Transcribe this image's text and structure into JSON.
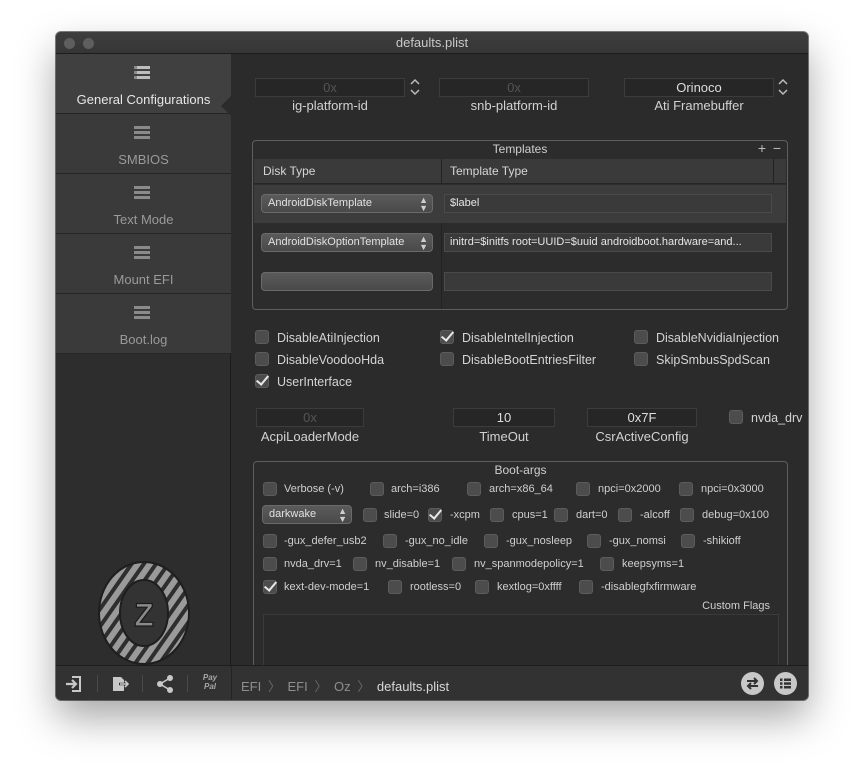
{
  "window": {
    "title": "defaults.plist"
  },
  "sidebar": {
    "items": [
      {
        "label": "General Configurations",
        "active": true
      },
      {
        "label": "SMBIOS",
        "active": false
      },
      {
        "label": "Text Mode",
        "active": false
      },
      {
        "label": "Mount EFI",
        "active": false
      },
      {
        "label": "Boot.log",
        "active": false
      }
    ],
    "logo_letter": "Z"
  },
  "platform": {
    "ig_platform_id": {
      "value": "0x",
      "label": "ig-platform-id"
    },
    "snb_platform_id": {
      "value": "0x",
      "label": "snb-platform-id"
    },
    "ati_framebuffer": {
      "value": "Orinoco",
      "label": "Ati Framebuffer"
    }
  },
  "templates": {
    "title": "Templates",
    "add": "+",
    "remove": "−",
    "columns": [
      "Disk Type",
      "Template Type"
    ],
    "rows": [
      {
        "disk_type": "AndroidDiskTemplate",
        "template": "$label"
      },
      {
        "disk_type": "AndroidDiskOptionTemplate",
        "template": "initrd=$initfs root=UUID=$uuid androidboot.hardware=and..."
      }
    ]
  },
  "options": [
    {
      "label": "DisableAtiInjection",
      "checked": false
    },
    {
      "label": "DisableIntelInjection",
      "checked": true
    },
    {
      "label": "DisableNvidiaInjection",
      "checked": false
    },
    {
      "label": "DisableVoodooHda",
      "checked": false
    },
    {
      "label": "DisableBootEntriesFilter",
      "checked": false
    },
    {
      "label": "SkipSmbusSpdScan",
      "checked": false
    },
    {
      "label": "UserInterface",
      "checked": true
    }
  ],
  "acpi": {
    "acpi_loader_mode": {
      "value": "0x",
      "label": "AcpiLoaderMode"
    },
    "timeout": {
      "value": "10",
      "label": "TimeOut"
    },
    "csr_active_config": {
      "value": "0x7F",
      "label": "CsrActiveConfig"
    },
    "nvda_drv": {
      "label": "nvda_drv",
      "checked": false
    }
  },
  "boot_args": {
    "title": "Boot-args",
    "darkwake_value": "darkwake",
    "items": [
      {
        "label": "Verbose (-v)",
        "checked": false
      },
      {
        "label": "arch=i386",
        "checked": false
      },
      {
        "label": "arch=x86_64",
        "checked": false
      },
      {
        "label": "npci=0x2000",
        "checked": false
      },
      {
        "label": "npci=0x3000",
        "checked": false
      },
      {
        "label": "slide=0",
        "checked": false
      },
      {
        "label": "-xcpm",
        "checked": true
      },
      {
        "label": "cpus=1",
        "checked": false
      },
      {
        "label": "dart=0",
        "checked": false
      },
      {
        "label": "-alcoff",
        "checked": false
      },
      {
        "label": "debug=0x100",
        "checked": false
      },
      {
        "label": "-gux_defer_usb2",
        "checked": false
      },
      {
        "label": "-gux_no_idle",
        "checked": false
      },
      {
        "label": "-gux_nosleep",
        "checked": false
      },
      {
        "label": "-gux_nomsi",
        "checked": false
      },
      {
        "label": "-shikioff",
        "checked": false
      },
      {
        "label": "nvda_drv=1",
        "checked": false
      },
      {
        "label": "nv_disable=1",
        "checked": false
      },
      {
        "label": "nv_spanmodepolicy=1",
        "checked": false
      },
      {
        "label": "keepsyms=1",
        "checked": false
      },
      {
        "label": "kext-dev-mode=1",
        "checked": true
      },
      {
        "label": "rootless=0",
        "checked": false
      },
      {
        "label": "kextlog=0xffff",
        "checked": false
      },
      {
        "label": "-disablegfxfirmware",
        "checked": false
      }
    ],
    "custom_flags_label": "Custom Flags",
    "custom_flags_value": ""
  },
  "bottom": {
    "paypal_line1": "Pay",
    "paypal_line2": "Pal",
    "breadcrumb": [
      "EFI",
      "EFI",
      "Oz",
      "defaults.plist"
    ],
    "crumb_sep": "〉"
  }
}
